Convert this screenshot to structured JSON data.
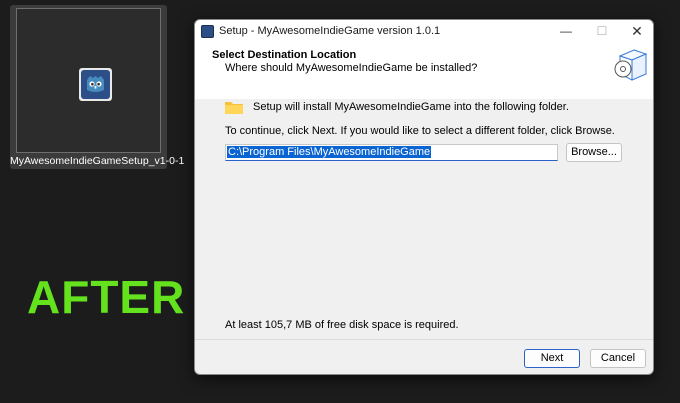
{
  "desktop": {
    "file_label": "MyAwesomeIndieGameSetup_v1-0-1",
    "caption": "AFTER"
  },
  "window": {
    "title": "Setup - MyAwesomeIndieGame version 1.0.1",
    "minimize_glyph": "—",
    "maximize_glyph": "☐",
    "close_glyph": "✕",
    "header_title": "Select Destination Location",
    "header_subtitle": "Where should MyAwesomeIndieGame be installed?",
    "install_line": "Setup will install MyAwesomeIndieGame into the following folder.",
    "continue_line": "To continue, click Next. If you would like to select a different folder, click Browse.",
    "path_value": "C:\\Program Files\\MyAwesomeIndieGame",
    "browse_label": "Browse...",
    "disk_space": "At least 105,7 MB of free disk space is required.",
    "next_label": "Next",
    "cancel_label": "Cancel"
  },
  "colors": {
    "caption_green": "#64e21e",
    "selection_blue": "#0a64d2",
    "app_icon_blue": "#2d4f87"
  },
  "icons": [
    "godot-app-icon",
    "folder-icon",
    "setup-wizard-box-icon"
  ]
}
